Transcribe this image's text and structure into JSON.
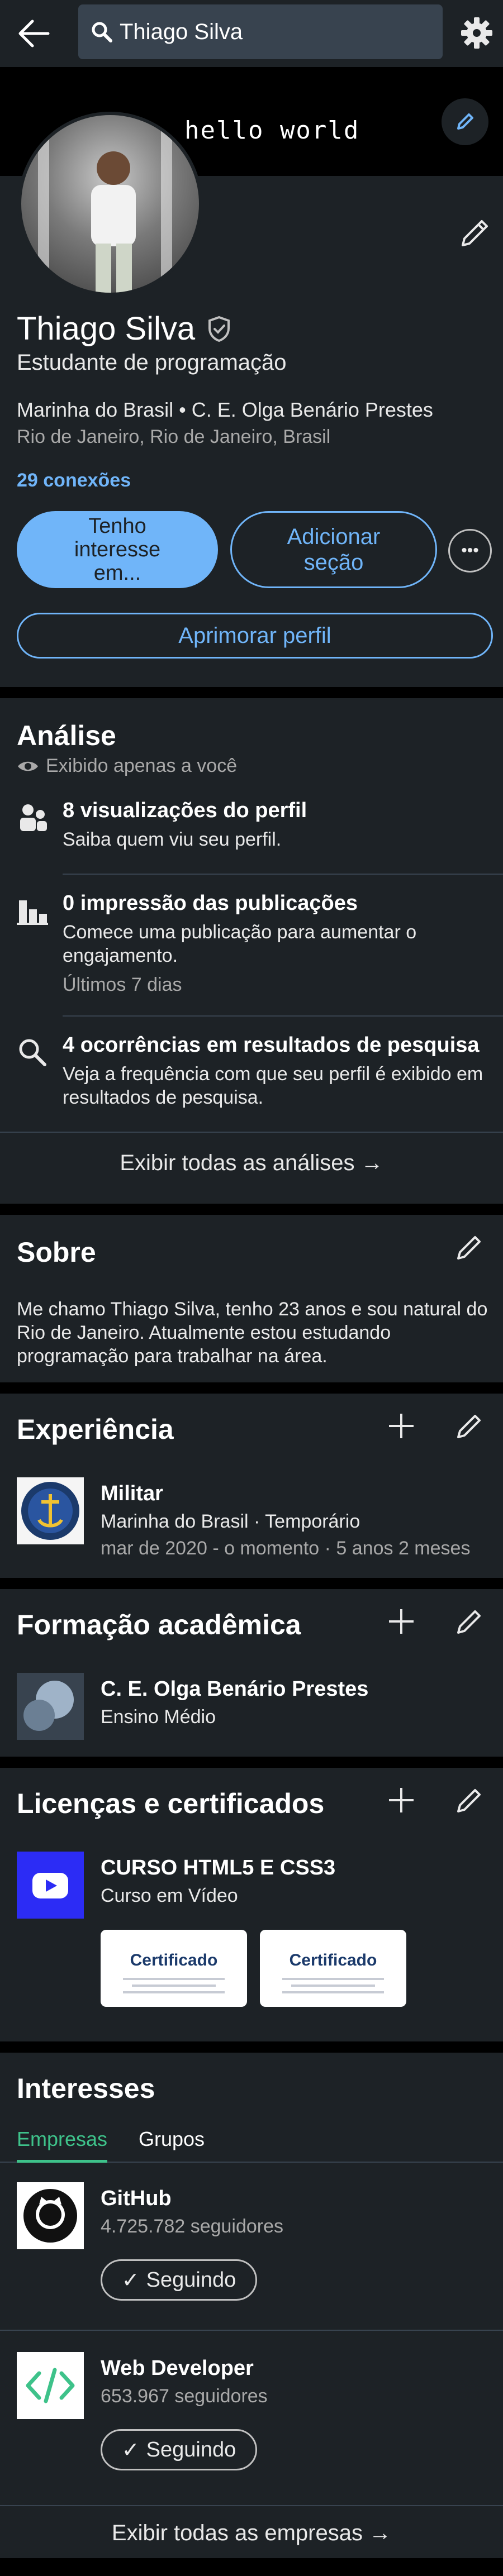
{
  "search": {
    "query": "Thiago Silva"
  },
  "banner": {
    "text": "hello world"
  },
  "profile": {
    "name": "Thiago Silva",
    "headline": "Estudante de programação",
    "org_line": "Marinha do Brasil • C. E. Olga Benário Prestes",
    "location": "Rio de Janeiro, Rio de Janeiro, Brasil",
    "connections": "29 conexões",
    "btn_interest": "Tenho interesse em...",
    "btn_add_section": "Adicionar seção",
    "btn_more": "•••",
    "btn_improve": "Aprimorar perfil"
  },
  "analytics": {
    "title": "Análise",
    "private_note": "Exibido apenas a você",
    "items": [
      {
        "title": "8 visualizações do perfil",
        "desc": "Saiba quem viu seu perfil.",
        "icon": "people-icon"
      },
      {
        "title": "0 impressão das publicações",
        "desc": "Comece uma publicação para aumentar o engajamento.",
        "meta": "Últimos 7 dias",
        "icon": "bar-chart-icon"
      },
      {
        "title": "4 ocorrências em resultados de pesquisa",
        "desc": "Veja a frequência com que seu perfil é exibido em resultados de pesquisa.",
        "icon": "search-icon"
      }
    ],
    "see_all": "Exibir todas as análises →"
  },
  "about": {
    "title": "Sobre",
    "text": "Me chamo Thiago Silva, tenho 23 anos e sou natural do Rio de Janeiro. Atualmente estou estudando programação para trabalhar na área."
  },
  "experience": {
    "title": "Experiência",
    "items": [
      {
        "role": "Militar",
        "org": "Marinha do Brasil · Temporário",
        "period": "mar de 2020 - o momento · 5 anos 2 meses"
      }
    ]
  },
  "education": {
    "title": "Formação acadêmica",
    "items": [
      {
        "school": "C. E. Olga Benário Prestes",
        "level": "Ensino Médio"
      }
    ]
  },
  "certifications": {
    "title": "Licenças e certificados",
    "items": [
      {
        "name": "CURSO HTML5 E CSS3",
        "issuer": "Curso em Vídeo",
        "thumb_label": "Certificado"
      }
    ]
  },
  "interests": {
    "title": "Interesses",
    "tabs": [
      "Empresas",
      "Grupos"
    ],
    "companies": [
      {
        "name": "GitHub",
        "followers": "4.725.782 seguidores",
        "button": "Seguindo"
      },
      {
        "name": "Web Developer",
        "followers": "653.967 seguidores",
        "button": "Seguindo"
      }
    ],
    "see_all": "Exibir todas as empresas →"
  },
  "colors": {
    "accent": "#70b5f9",
    "card_bg": "#1d2226",
    "tab_active": "#3ec28a"
  }
}
